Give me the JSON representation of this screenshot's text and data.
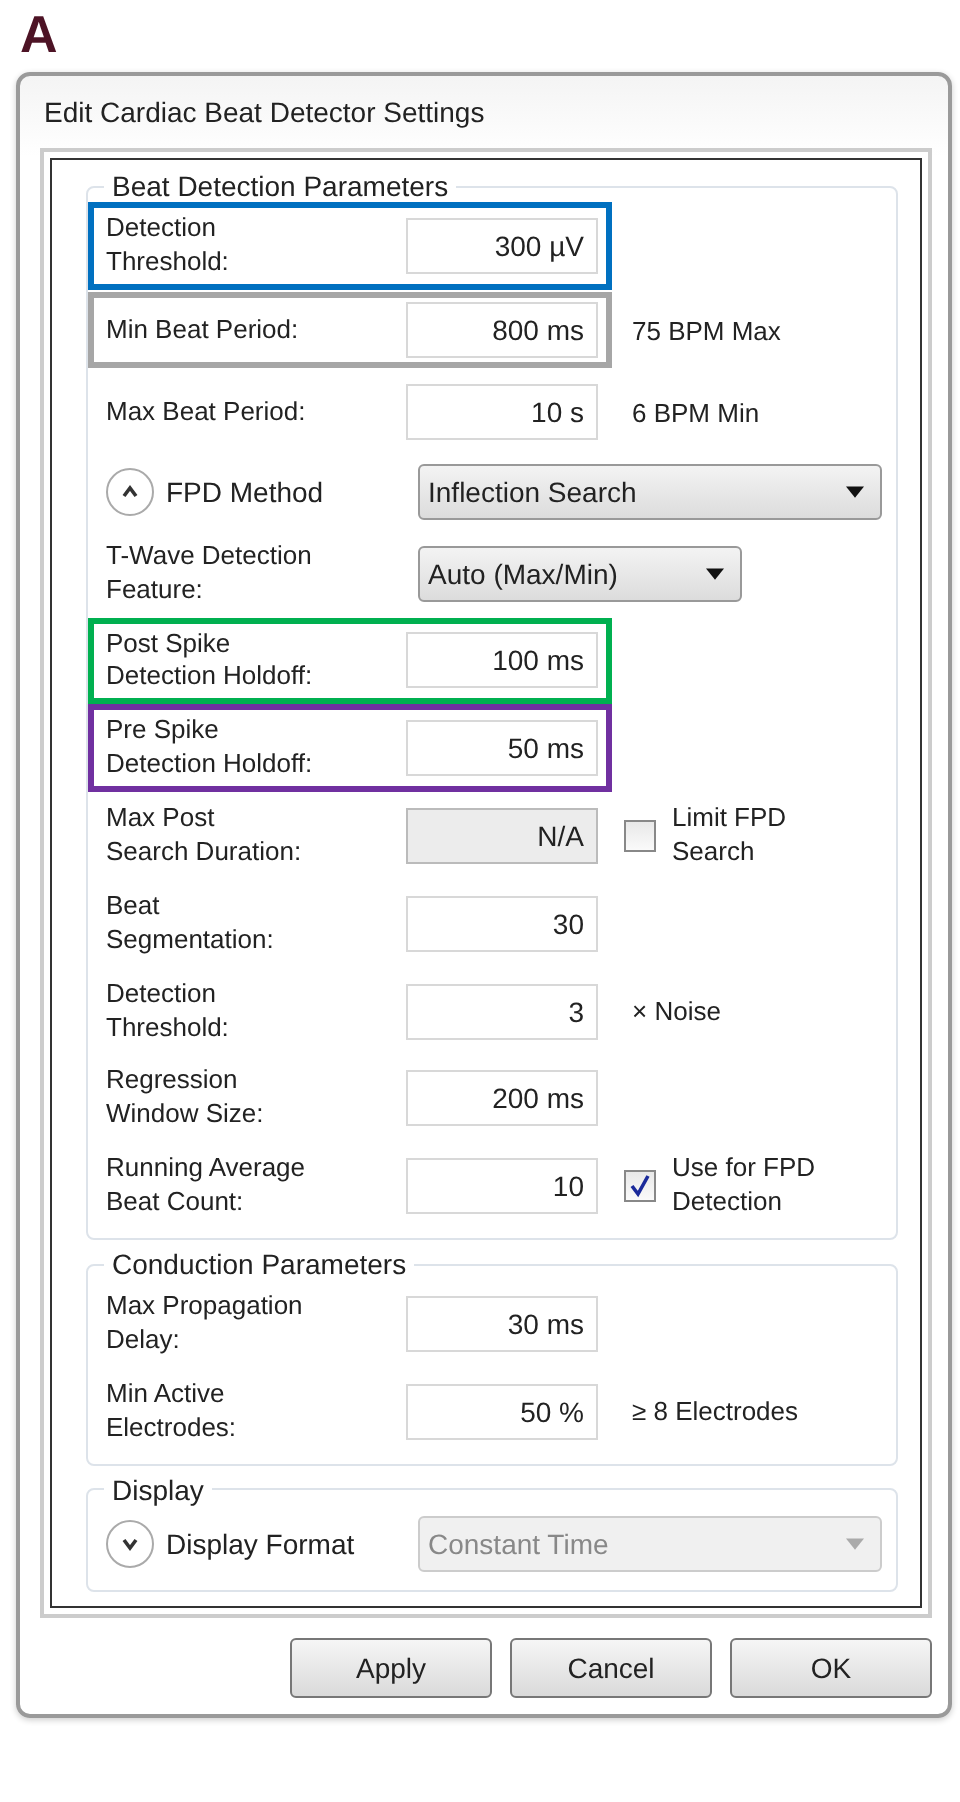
{
  "figure_label": "A",
  "window": {
    "title": "Edit Cardiac Beat Detector Settings"
  },
  "groups": [
    {
      "title": "Beat Detection Parameters",
      "rows": [
        {
          "kind": "field",
          "label": "Detection\nThreshold:",
          "value": "300 µV",
          "color": "#0070c0"
        },
        {
          "kind": "field",
          "label": "Min Beat Period:",
          "value": "800 ms",
          "note": "75 BPM Max",
          "color": "#a6a6a6"
        },
        {
          "kind": "field",
          "label": "Max Beat Period:",
          "value": "10 s",
          "note": "6 BPM Min"
        },
        {
          "kind": "select",
          "expander": {
            "expanded": true
          },
          "label": "FPD Method",
          "value": "Inflection Search",
          "disabled": false
        },
        {
          "kind": "select",
          "label": "T-Wave Detection\nFeature:",
          "value": "Auto (Max/Min)",
          "disabled": false
        },
        {
          "kind": "field",
          "label": "Post Spike\nDetection Holdoff:",
          "value": "100 ms",
          "color": "#00b050"
        },
        {
          "kind": "field",
          "label": "Pre Spike\nDetection Holdoff:",
          "value": "50 ms",
          "color": "#7030a0"
        },
        {
          "kind": "field",
          "label": "Max Post\nSearch Duration:",
          "value": "N/A",
          "disabled": true,
          "checkbox": {
            "label": "Limit FPD\nSearch",
            "checked": false
          }
        },
        {
          "kind": "field",
          "label": "Beat\nSegmentation:",
          "value": "30"
        },
        {
          "kind": "field",
          "label": "Detection\nThreshold:",
          "value": "3",
          "note": "× Noise"
        },
        {
          "kind": "field",
          "label": "Regression\nWindow Size:",
          "value": "200 ms"
        },
        {
          "kind": "field",
          "label": "Running Average\nBeat Count:",
          "value": "10",
          "checkbox": {
            "label": "Use for FPD\nDetection",
            "checked": true
          }
        }
      ]
    },
    {
      "title": "Conduction Parameters",
      "rows": [
        {
          "kind": "field",
          "label": "Max Propagation\nDelay:",
          "value": "30 ms"
        },
        {
          "kind": "field",
          "label": "Min Active\nElectrodes:",
          "value": "50 %",
          "note": "≥ 8 Electrodes"
        }
      ]
    },
    {
      "title": "Display",
      "rows": [
        {
          "kind": "select",
          "expander": {
            "expanded": false
          },
          "label": "Display Format",
          "value": "Constant Time",
          "disabled": true
        }
      ]
    }
  ],
  "buttons": [
    "Apply",
    "Cancel",
    "OK"
  ]
}
